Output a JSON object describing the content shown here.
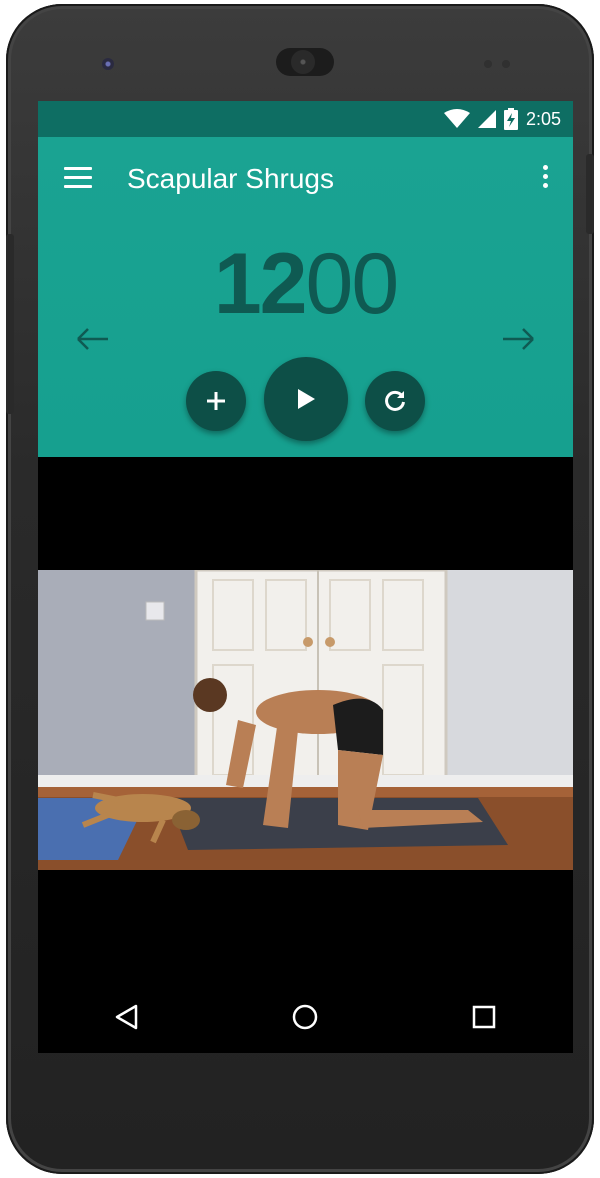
{
  "status_bar": {
    "time": "2:05"
  },
  "app_bar": {
    "title": "Scapular Shrugs"
  },
  "counter": {
    "bold_part": "12",
    "light_part": "00"
  },
  "colors": {
    "primary": "#1aa392",
    "primary_dark": "#0e6e63",
    "accent": "#0d4f47"
  },
  "icons": {
    "menu": "menu-icon",
    "more": "more-vert-icon",
    "prev": "arrow-back-icon",
    "next": "arrow-forward-icon",
    "add": "add-icon",
    "play": "play-icon",
    "replay": "replay-icon",
    "nav_back": "back-triangle-icon",
    "nav_home": "home-circle-icon",
    "nav_recents": "recents-square-icon"
  }
}
